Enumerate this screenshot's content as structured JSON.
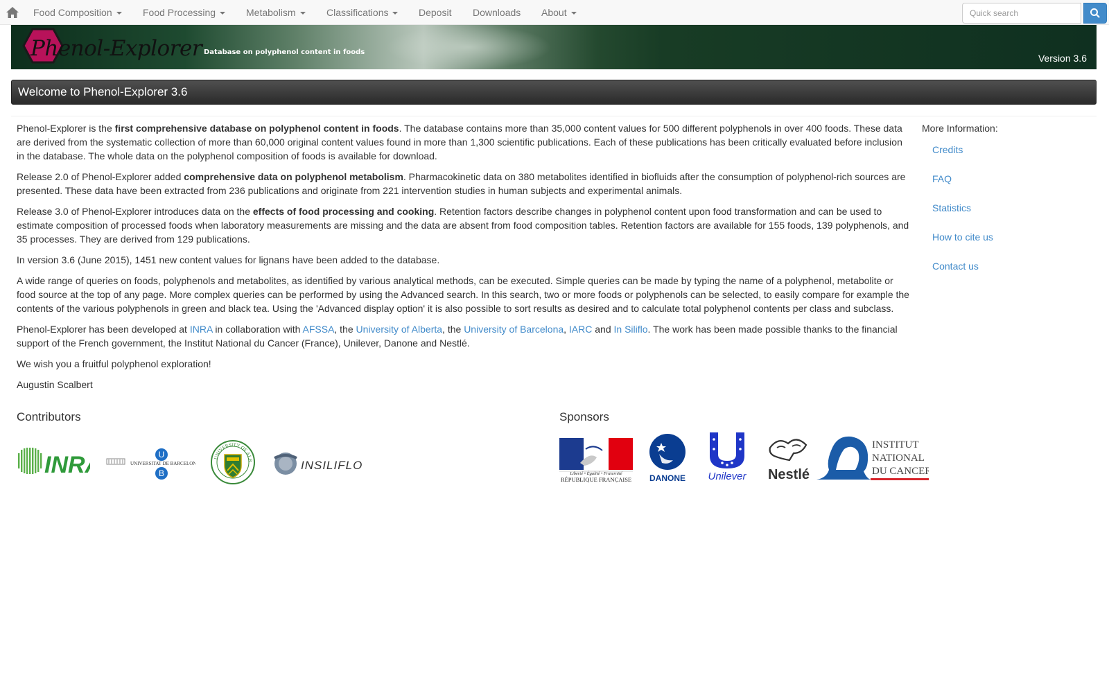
{
  "navbar": {
    "items": [
      {
        "label": "Food Composition",
        "dropdown": true
      },
      {
        "label": "Food Processing",
        "dropdown": true
      },
      {
        "label": "Metabolism",
        "dropdown": true
      },
      {
        "label": "Classifications",
        "dropdown": true
      },
      {
        "label": "Deposit",
        "dropdown": false
      },
      {
        "label": "Downloads",
        "dropdown": false
      },
      {
        "label": "About",
        "dropdown": true
      }
    ],
    "search_placeholder": "Quick search"
  },
  "banner": {
    "logo_text": "Phenol-Explorer",
    "tagline": "Database on polyphenol content in foods",
    "version": "Version 3.6"
  },
  "welcome_title": "Welcome to Phenol-Explorer 3.6",
  "intro": {
    "p1_a": "Phenol-Explorer is the ",
    "p1_bold": "first comprehensive database on polyphenol content in foods",
    "p1_b": ". The database contains more than 35,000 content values for 500 different polyphenols in over 400 foods. These data are derived from the systematic collection of more than 60,000 original content values found in more than 1,300 scientific publications. Each of these publications has been critically evaluated before inclusion in the database. The whole data on the polyphenol composition of foods is available for download.",
    "p2_a": "Release 2.0 of Phenol-Explorer added ",
    "p2_bold": "comprehensive data on polyphenol metabolism",
    "p2_b": ". Pharmacokinetic data on 380 metabolites identified in biofluids after the consumption of polyphenol-rich sources are presented. These data have been extracted from 236 publications and originate from 221 intervention studies in human subjects and experimental animals.",
    "p3_a": "Release 3.0 of Phenol-Explorer introduces data on the ",
    "p3_bold": "effects of food processing and cooking",
    "p3_b": ". Retention factors describe changes in polyphenol content upon food transformation and can be used to estimate composition of processed foods when laboratory measurements are missing and the data are absent from food composition tables. Retention factors are available for 155 foods, 139 polyphenols, and 35 processes. They are derived from 129 publications.",
    "p4": "In version 3.6 (June 2015), 1451 new content values for lignans have been added to the database.",
    "p5": "A wide range of queries on foods, polyphenols and metabolites, as identified by various analytical methods, can be executed. Simple queries can be made by typing the name of a polyphenol, metabolite or food source at the top of any page. More complex queries can be performed by using the Advanced search. In this search, two or more foods or polyphenols can be selected, to easily compare for example the contents of the various polyphenols in green and black tea. Using the 'Advanced display option' it is also possible to sort results as desired and to calculate total polyphenol contents per class and subclass.",
    "p6_a": "Phenol-Explorer has been developed at ",
    "p6_link1": "INRA",
    "p6_b": " in collaboration with ",
    "p6_link2": "AFSSA",
    "p6_c": ", the ",
    "p6_link3": "University of Alberta",
    "p6_d": ", the ",
    "p6_link4": "University of Barcelona",
    "p6_e": ", ",
    "p6_link5": "IARC",
    "p6_f": " and ",
    "p6_link6": "In Siliflo",
    "p6_g": ". The work has been made possible thanks to the financial support of the French government, the Institut National du Cancer (France), Unilever, Danone and Nestlé.",
    "p7": "We wish you a fruitful polyphenol exploration!",
    "p8": "Augustin Scalbert"
  },
  "sidebar": {
    "title": "More Information:",
    "links": [
      "Credits",
      "FAQ",
      "Statistics",
      "How to cite us",
      "Contact us"
    ]
  },
  "contributors": {
    "title": "Contributors",
    "inra_text": "INRA",
    "ub_text": "UNIVERSITAT DE BARCELONA",
    "ub_letter_u": "U",
    "ub_letter_b": "B",
    "ualberta_text": "UNIVERSITY OF ALBERTA",
    "insiliflo_text": "INSILIFLO"
  },
  "sponsors": {
    "title": "Sponsors",
    "rf_text": "Liberté • Égalité • Fraternité",
    "rf_text2": "RÉPUBLIQUE FRANÇAISE",
    "danone_text": "DANONE",
    "unilever_text": "Unilever",
    "nestle_text": "Nestlé",
    "inca_line1": "INSTITUT",
    "inca_line2": "NATIONAL",
    "inca_line3": "DU CANCER"
  }
}
